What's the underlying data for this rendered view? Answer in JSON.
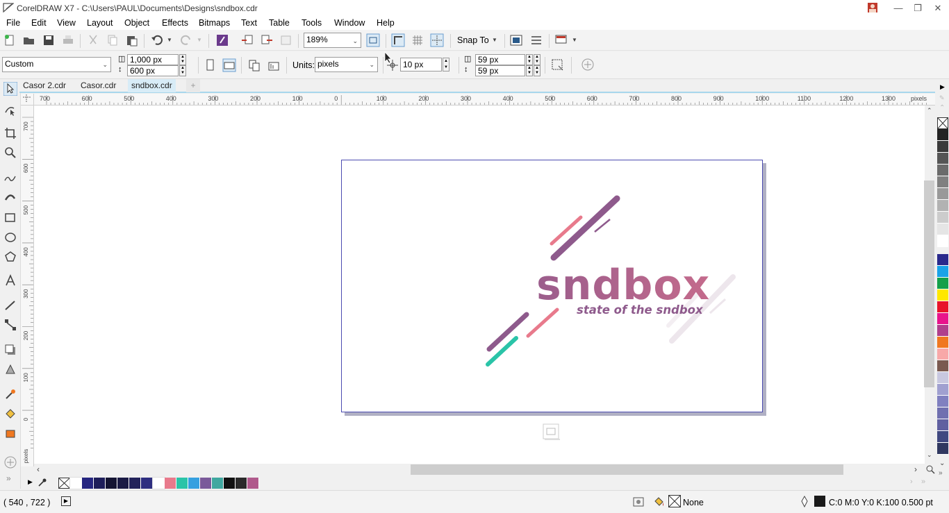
{
  "window": {
    "title": "CorelDRAW X7 - C:\\Users\\PAUL\\Documents\\Designs\\sndbox.cdr",
    "buttons": [
      "user-icon",
      "minimize-icon",
      "restore-icon",
      "close-icon"
    ]
  },
  "menu": [
    "File",
    "Edit",
    "View",
    "Layout",
    "Object",
    "Effects",
    "Bitmaps",
    "Text",
    "Table",
    "Tools",
    "Window",
    "Help"
  ],
  "standard_toolbar": {
    "zoom_level": "189%",
    "snap_to_label": "Snap To"
  },
  "property_bar": {
    "page_preset": "Custom",
    "page_width": "1,000 px",
    "page_height": "600 px",
    "units_label": "Units:",
    "units_value": "pixels",
    "nudge_distance": "10 px",
    "duplicate_x": "59 px",
    "duplicate_y": "59 px"
  },
  "tabs": [
    {
      "label": "Casor 2.cdr",
      "active": false
    },
    {
      "label": "Casor.cdr",
      "active": false
    },
    {
      "label": "sndbox.cdr",
      "active": true
    }
  ],
  "rulers": {
    "h_labels": [
      "700",
      "600",
      "500",
      "400",
      "300",
      "200",
      "100",
      "0",
      "100",
      "200",
      "300",
      "400",
      "500",
      "600",
      "700",
      "800",
      "900",
      "1000",
      "1100",
      "1200",
      "1300"
    ],
    "h_unit": "pixels",
    "v_labels": [
      "700",
      "600",
      "500",
      "400",
      "300",
      "200",
      "100",
      "0"
    ],
    "v_unit": "pixels"
  },
  "artwork": {
    "logo_text": "sndbox",
    "tagline": "state of the sndbox",
    "colors": {
      "purple": "#8e5a8c",
      "pink": "#e87a8c",
      "teal": "#2ac4a8",
      "gradient_start": "#9b5d8c",
      "gradient_end": "#c46b8c",
      "ghost": "#ede6ec"
    }
  },
  "palette_right": [
    "#232323",
    "#3a3a3a",
    "#555555",
    "#6b6b6b",
    "#808080",
    "#999999",
    "#b2b2b2",
    "#cccccc",
    "#e5e5e5",
    "#ffffff",
    "#2a2a8c",
    "#1aa3e8",
    "#14a04a",
    "#ffe800",
    "#e8142a",
    "#e8148c",
    "#b0408c",
    "#f07820",
    "#f8a8a8",
    "#7a5a50",
    "#c8c8e0",
    "#a0a0d0",
    "#8080c0",
    "#7070b0",
    "#6060a0",
    "#404880",
    "#303860"
  ],
  "palette_doc": [
    "#ffffff",
    "#262680",
    "#1e1e5a",
    "#141432",
    "#1a1a44",
    "#22225a",
    "#2e2e80",
    "#ffffff",
    "#e87a8c",
    "#2ac4a8",
    "#36a0e0",
    "#7a5a9a",
    "#40a8a0",
    "#111111",
    "#2a2a2a",
    "#b05a8c"
  ],
  "status": {
    "cursor_coords": "( 540  , 722   )",
    "fill_label": "None",
    "outline_info": "C:0 M:0 Y:0 K:100  0.500 pt"
  }
}
